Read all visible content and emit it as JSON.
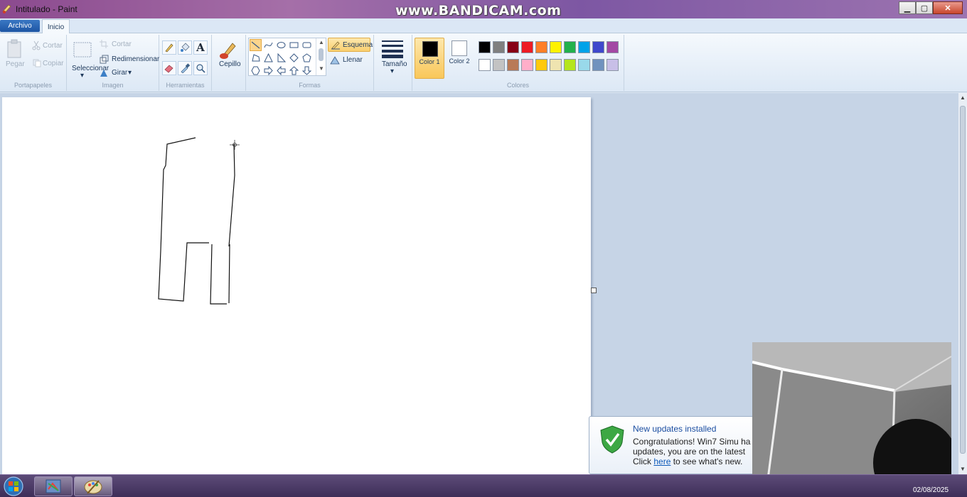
{
  "window": {
    "title": "Intitulado - Paint",
    "watermark": "www.BANDICAM.com"
  },
  "tabs": {
    "archivo": "Archivo",
    "inicio": "Inicio"
  },
  "ribbon": {
    "portapapeles": {
      "group_label": "Portapapeles",
      "pegar": "Pegar",
      "cortar": "Cortar",
      "copiar": "Copiar"
    },
    "imagen": {
      "group_label": "Imagen",
      "seleccionar": "Seleccionar",
      "recortar": "Cortar",
      "redimensionar": "Redimensionar",
      "girar": "Girar"
    },
    "herramientas": {
      "group_label": "Herramientas"
    },
    "pinceles": {
      "cepillo": "Cepillo"
    },
    "formas": {
      "group_label": "Formas",
      "esquema": "Esquema",
      "llenar": "Llenar"
    },
    "tamano": "Tamaño",
    "colores": {
      "group_label": "Colores",
      "color1": "Color 1",
      "color2": "Color 2",
      "color1_value": "#000000",
      "color2_value": "#ffffff",
      "palette_row1": [
        "#000000",
        "#7f7f7f",
        "#880015",
        "#ed1c24",
        "#ff7f27",
        "#fff200",
        "#22b14c",
        "#00a2e8",
        "#3f48cc",
        "#a349a4"
      ],
      "palette_row2": [
        "#ffffff",
        "#c3c3c3",
        "#b97a57",
        "#ffaec9",
        "#ffc90e",
        "#efe4b0",
        "#b5e61d",
        "#99d9ea",
        "#7092be",
        "#c8bfe7"
      ]
    }
  },
  "notification": {
    "title": "New updates installed",
    "line1": "Congratulations! Win7 Simu ha",
    "line2": "updates, you are on the latest",
    "line3_prefix": "Click ",
    "line3_link": "here",
    "line3_suffix": " to see what's new."
  },
  "taskbar": {
    "clock": "02/08/2025"
  }
}
